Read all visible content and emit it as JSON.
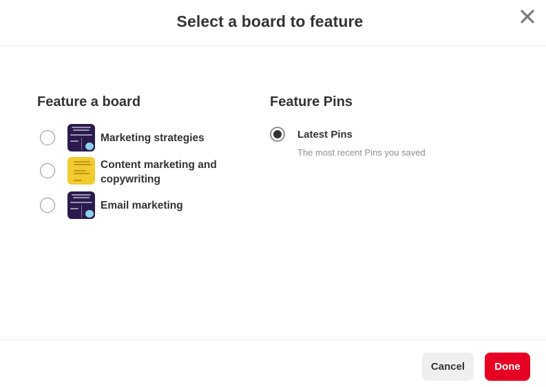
{
  "dialog": {
    "title": "Select a board to feature",
    "close_icon": "close-icon"
  },
  "feature_board": {
    "heading": "Feature a board",
    "boards": [
      {
        "label": "Marketing strategies",
        "selected": false,
        "thumbnail": "purple"
      },
      {
        "label": "Content marketing and copywriting",
        "selected": false,
        "thumbnail": "yellow"
      },
      {
        "label": "Email marketing",
        "selected": false,
        "thumbnail": "purple"
      }
    ]
  },
  "feature_pins": {
    "heading": "Feature Pins",
    "options": [
      {
        "label": "Latest Pins",
        "description": "The most recent Pins you saved",
        "selected": true
      }
    ]
  },
  "footer": {
    "cancel_label": "Cancel",
    "done_label": "Done"
  },
  "colors": {
    "primary": "#e60023",
    "secondary_button": "#efefef",
    "text": "#333333",
    "muted_text": "#8e8e8e"
  }
}
